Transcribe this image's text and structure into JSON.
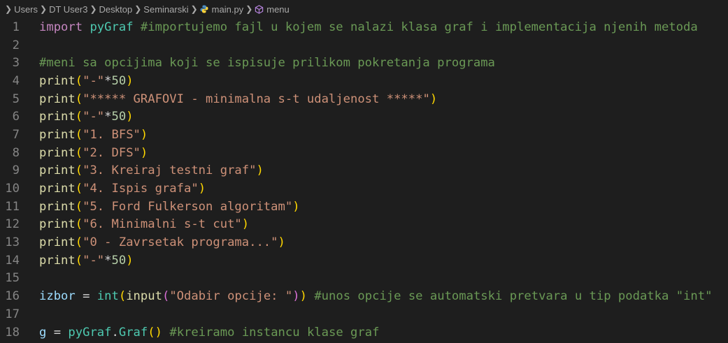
{
  "breadcrumb": {
    "items": [
      "Users",
      "DT User3",
      "Desktop",
      "Seminarski",
      "main.py",
      "menu"
    ]
  },
  "icons": {
    "chevron": "chevron-right-icon",
    "python": "python-file-icon",
    "symbol": "symbol-method-icon"
  },
  "colors": {
    "background": "#1e1e1e",
    "keyword": "#c586c0",
    "string": "#ce9178",
    "comment": "#6a9955",
    "function": "#dcdcaa",
    "number": "#b5cea8",
    "variable": "#9cdcfe",
    "class": "#4ec9b0",
    "line_number": "#858585"
  },
  "editor": {
    "lines": [
      [
        {
          "t": "import",
          "c": "kw"
        },
        {
          "t": " "
        },
        {
          "t": "pyGraf",
          "c": "cls"
        },
        {
          "t": " "
        },
        {
          "t": "#importujemo fajl u kojem se nalazi klasa graf i implementacija njenih metoda",
          "c": "cm"
        }
      ],
      [],
      [
        {
          "t": "#meni sa opcijima koji se ispisuje prilikom pokretanja programa",
          "c": "cm"
        }
      ],
      [
        {
          "t": "print",
          "c": "fn"
        },
        {
          "t": "(",
          "c": "paren"
        },
        {
          "t": "\"-\"",
          "c": "str"
        },
        {
          "t": "*",
          "c": "op"
        },
        {
          "t": "50",
          "c": "num"
        },
        {
          "t": ")",
          "c": "paren"
        }
      ],
      [
        {
          "t": "print",
          "c": "fn"
        },
        {
          "t": "(",
          "c": "paren"
        },
        {
          "t": "\"***** GRAFOVI - minimalna s-t udaljenost *****\"",
          "c": "str"
        },
        {
          "t": ")",
          "c": "paren"
        }
      ],
      [
        {
          "t": "print",
          "c": "fn"
        },
        {
          "t": "(",
          "c": "paren"
        },
        {
          "t": "\"-\"",
          "c": "str"
        },
        {
          "t": "*",
          "c": "op"
        },
        {
          "t": "50",
          "c": "num"
        },
        {
          "t": ")",
          "c": "paren"
        }
      ],
      [
        {
          "t": "print",
          "c": "fn"
        },
        {
          "t": "(",
          "c": "paren"
        },
        {
          "t": "\"1. BFS\"",
          "c": "str"
        },
        {
          "t": ")",
          "c": "paren"
        }
      ],
      [
        {
          "t": "print",
          "c": "fn"
        },
        {
          "t": "(",
          "c": "paren"
        },
        {
          "t": "\"2. DFS\"",
          "c": "str"
        },
        {
          "t": ")",
          "c": "paren"
        }
      ],
      [
        {
          "t": "print",
          "c": "fn"
        },
        {
          "t": "(",
          "c": "paren"
        },
        {
          "t": "\"3. Kreiraj testni graf\"",
          "c": "str"
        },
        {
          "t": ")",
          "c": "paren"
        }
      ],
      [
        {
          "t": "print",
          "c": "fn"
        },
        {
          "t": "(",
          "c": "paren"
        },
        {
          "t": "\"4. Ispis grafa\"",
          "c": "str"
        },
        {
          "t": ")",
          "c": "paren"
        }
      ],
      [
        {
          "t": "print",
          "c": "fn"
        },
        {
          "t": "(",
          "c": "paren"
        },
        {
          "t": "\"5. Ford Fulkerson algoritam\"",
          "c": "str"
        },
        {
          "t": ")",
          "c": "paren"
        }
      ],
      [
        {
          "t": "print",
          "c": "fn"
        },
        {
          "t": "(",
          "c": "paren"
        },
        {
          "t": "\"6. Minimalni s-t cut\"",
          "c": "str"
        },
        {
          "t": ")",
          "c": "paren"
        }
      ],
      [
        {
          "t": "print",
          "c": "fn"
        },
        {
          "t": "(",
          "c": "paren"
        },
        {
          "t": "\"0 - Zavrsetak programa...\"",
          "c": "str"
        },
        {
          "t": ")",
          "c": "paren"
        }
      ],
      [
        {
          "t": "print",
          "c": "fn"
        },
        {
          "t": "(",
          "c": "paren"
        },
        {
          "t": "\"-\"",
          "c": "str"
        },
        {
          "t": "*",
          "c": "op"
        },
        {
          "t": "50",
          "c": "num"
        },
        {
          "t": ")",
          "c": "paren"
        }
      ],
      [],
      [
        {
          "t": "izbor",
          "c": "var"
        },
        {
          "t": " = ",
          "c": "op"
        },
        {
          "t": "int",
          "c": "cls"
        },
        {
          "t": "(",
          "c": "paren"
        },
        {
          "t": "input",
          "c": "fn"
        },
        {
          "t": "(",
          "c": "paren2"
        },
        {
          "t": "\"Odabir opcije: \"",
          "c": "str"
        },
        {
          "t": ")",
          "c": "paren2"
        },
        {
          "t": ")",
          "c": "paren"
        },
        {
          "t": " "
        },
        {
          "t": "#unos opcije se automatski pretvara u tip podatka \"int\"",
          "c": "cm"
        }
      ],
      [],
      [
        {
          "t": "g",
          "c": "var"
        },
        {
          "t": " = ",
          "c": "op"
        },
        {
          "t": "pyGraf",
          "c": "cls"
        },
        {
          "t": ".",
          "c": "op"
        },
        {
          "t": "Graf",
          "c": "cls"
        },
        {
          "t": "(",
          "c": "paren"
        },
        {
          "t": ")",
          "c": "paren"
        },
        {
          "t": " "
        },
        {
          "t": "#kreiramo instancu klase graf",
          "c": "cm"
        }
      ]
    ]
  }
}
